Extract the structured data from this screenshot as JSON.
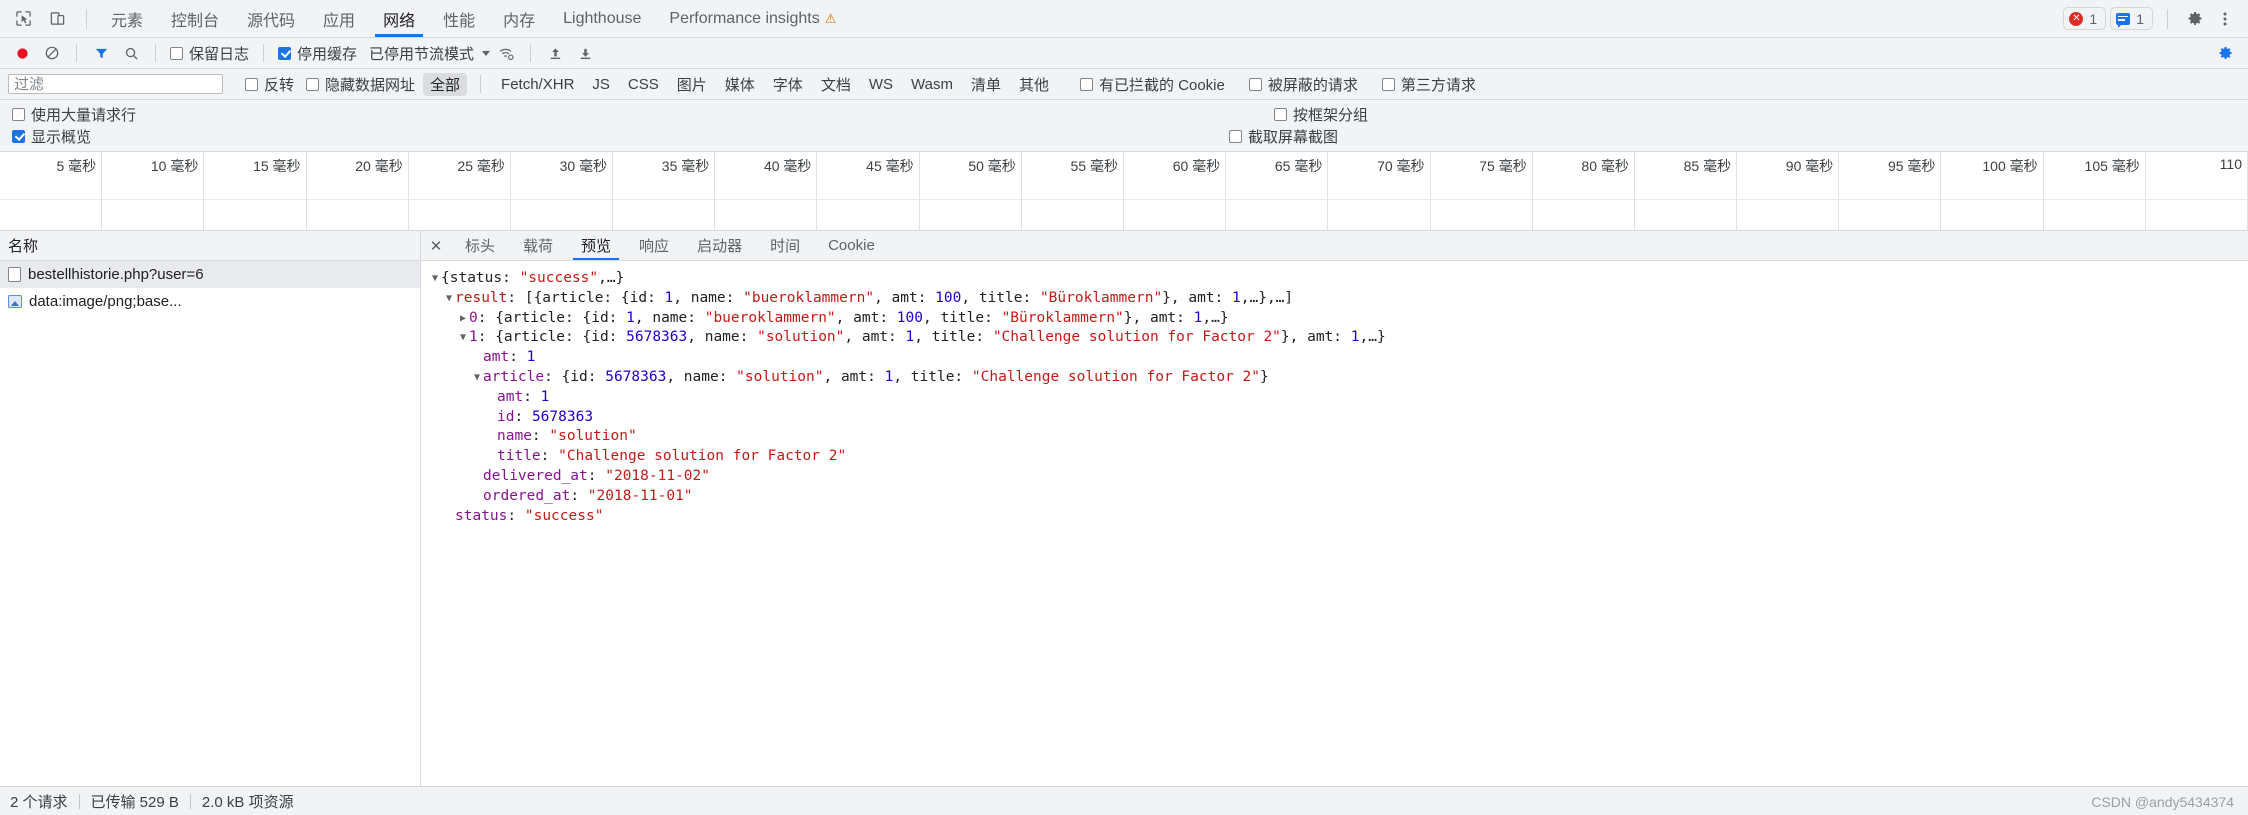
{
  "window": {
    "title": "Chrome DevTools - Network"
  },
  "toolbar": {
    "inspect_icon": "inspect-cursor-icon",
    "device_icon": "device-toggle-icon",
    "tabs": [
      {
        "label": "元素",
        "selected": false,
        "warning": false
      },
      {
        "label": "控制台",
        "selected": false,
        "warning": false
      },
      {
        "label": "源代码",
        "selected": false,
        "warning": false
      },
      {
        "label": "应用",
        "selected": false,
        "warning": false
      },
      {
        "label": "网络",
        "selected": true,
        "warning": false
      },
      {
        "label": "性能",
        "selected": false,
        "warning": false
      },
      {
        "label": "内存",
        "selected": false,
        "warning": false
      },
      {
        "label": "Lighthouse",
        "selected": false,
        "warning": false
      },
      {
        "label": "Performance insights",
        "selected": false,
        "warning": true
      }
    ],
    "warning_glyph": "⚠",
    "error_badge": {
      "icon": "error-circle-icon",
      "count": "1"
    },
    "message_badge": {
      "icon": "message-box-icon",
      "count": "1"
    },
    "settings_icon": "gear-icon",
    "more_icon": "kebab-menu-icon"
  },
  "network_controls": {
    "record_icon": "record-circle-icon",
    "clear_icon": "clear-prohibited-icon",
    "filter_icon": "filter-funnel-icon",
    "search_icon": "search-magnifier-icon",
    "preserve_log": {
      "label": "保留日志",
      "checked": false
    },
    "disable_cache": {
      "label": "停用缓存",
      "checked": true
    },
    "throttling": {
      "label": "已停用节流模式",
      "caret": "▾"
    },
    "wifi_icon": "network-conditions-icon",
    "import_icon": "import-har-upload-icon",
    "export_icon": "export-har-download-icon",
    "settings_icon": "network-settings-gear-icon"
  },
  "filter_bar": {
    "filter_input": {
      "placeholder": "过滤",
      "value": ""
    },
    "invert": {
      "label": "反转",
      "checked": false
    },
    "hide_data_urls": {
      "label": "隐藏数据网址",
      "checked": false
    },
    "types": [
      {
        "label": "全部",
        "selected": true
      },
      {
        "label": "Fetch/XHR",
        "selected": false
      },
      {
        "label": "JS",
        "selected": false
      },
      {
        "label": "CSS",
        "selected": false
      },
      {
        "label": "图片",
        "selected": false
      },
      {
        "label": "媒体",
        "selected": false
      },
      {
        "label": "字体",
        "selected": false
      },
      {
        "label": "文档",
        "selected": false
      },
      {
        "label": "WS",
        "selected": false
      },
      {
        "label": "Wasm",
        "selected": false
      },
      {
        "label": "清单",
        "selected": false
      },
      {
        "label": "其他",
        "selected": false
      }
    ],
    "blocked_cookies": {
      "label": "有已拦截的 Cookie",
      "checked": false
    },
    "blocked_requests": {
      "label": "被屏蔽的请求",
      "checked": false
    },
    "third_party": {
      "label": "第三方请求",
      "checked": false
    }
  },
  "options": {
    "big_request_rows": {
      "label": "使用大量请求行",
      "checked": false
    },
    "group_by_frame": {
      "label": "按框架分组",
      "checked": false
    },
    "show_overview": {
      "label": "显示概览",
      "checked": true
    },
    "capture_screenshots": {
      "label": "截取屏幕截图",
      "checked": false
    }
  },
  "overview": {
    "unit": "毫秒",
    "ticks": [
      "5 毫秒",
      "10 毫秒",
      "15 毫秒",
      "20 毫秒",
      "25 毫秒",
      "30 毫秒",
      "35 毫秒",
      "40 毫秒",
      "45 毫秒",
      "50 毫秒",
      "55 毫秒",
      "60 毫秒",
      "65 毫秒",
      "70 毫秒",
      "75 毫秒",
      "80 毫秒",
      "85 毫秒",
      "90 毫秒",
      "95 毫秒",
      "100 毫秒",
      "105 毫秒",
      "110"
    ],
    "tick_interval_ms": 5,
    "max_ms": 110
  },
  "request_list": {
    "column_header": "名称",
    "rows": [
      {
        "name": "bestellhistorie.php?user=6",
        "icon": "document-file-icon",
        "selected": true
      },
      {
        "name": "data:image/png;base...",
        "icon": "image-file-icon",
        "selected": false
      }
    ]
  },
  "detail_panel": {
    "close_label": "✕",
    "tabs": [
      {
        "label": "标头",
        "selected": false
      },
      {
        "label": "载荷",
        "selected": false
      },
      {
        "label": "预览",
        "selected": true
      },
      {
        "label": "响应",
        "selected": false
      },
      {
        "label": "启动器",
        "selected": false
      },
      {
        "label": "时间",
        "selected": false
      },
      {
        "label": "Cookie",
        "selected": false
      }
    ],
    "preview_tree": [
      {
        "indent": 0,
        "tri": "▼",
        "segments": [
          {
            "t": "{status: ",
            "c": "plain"
          },
          {
            "t": "\"success\"",
            "c": "str"
          },
          {
            "t": ",…}",
            "c": "plain"
          }
        ]
      },
      {
        "indent": 1,
        "tri": "▼",
        "segments": [
          {
            "t": "result",
            "c": "k-res"
          },
          {
            "t": ": [{article: {id: ",
            "c": "plain"
          },
          {
            "t": "1",
            "c": "num"
          },
          {
            "t": ", name: ",
            "c": "plain"
          },
          {
            "t": "\"bueroklammern\"",
            "c": "str"
          },
          {
            "t": ", amt: ",
            "c": "plain"
          },
          {
            "t": "100",
            "c": "num"
          },
          {
            "t": ", title: ",
            "c": "plain"
          },
          {
            "t": "\"Büroklammern\"",
            "c": "str"
          },
          {
            "t": "}, amt: ",
            "c": "plain"
          },
          {
            "t": "1",
            "c": "num"
          },
          {
            "t": ",…},…]",
            "c": "plain"
          }
        ]
      },
      {
        "indent": 2,
        "tri": "▶",
        "segments": [
          {
            "t": "0",
            "c": "k-name"
          },
          {
            "t": ": {article: {id: ",
            "c": "plain"
          },
          {
            "t": "1",
            "c": "num"
          },
          {
            "t": ", name: ",
            "c": "plain"
          },
          {
            "t": "\"bueroklammern\"",
            "c": "str"
          },
          {
            "t": ", amt: ",
            "c": "plain"
          },
          {
            "t": "100",
            "c": "num"
          },
          {
            "t": ", title: ",
            "c": "plain"
          },
          {
            "t": "\"Büroklammern\"",
            "c": "str"
          },
          {
            "t": "}, amt: ",
            "c": "plain"
          },
          {
            "t": "1",
            "c": "num"
          },
          {
            "t": ",…}",
            "c": "plain"
          }
        ]
      },
      {
        "indent": 2,
        "tri": "▼",
        "segments": [
          {
            "t": "1",
            "c": "k-name"
          },
          {
            "t": ": {article: {id: ",
            "c": "plain"
          },
          {
            "t": "5678363",
            "c": "num"
          },
          {
            "t": ", name: ",
            "c": "plain"
          },
          {
            "t": "\"solution\"",
            "c": "str"
          },
          {
            "t": ", amt: ",
            "c": "plain"
          },
          {
            "t": "1",
            "c": "num"
          },
          {
            "t": ", title: ",
            "c": "plain"
          },
          {
            "t": "\"Challenge solution for Factor 2\"",
            "c": "str"
          },
          {
            "t": "}, amt: ",
            "c": "plain"
          },
          {
            "t": "1",
            "c": "num"
          },
          {
            "t": ",…}",
            "c": "plain"
          }
        ]
      },
      {
        "indent": 3,
        "tri": "",
        "segments": [
          {
            "t": "amt",
            "c": "k-name"
          },
          {
            "t": ": ",
            "c": "plain"
          },
          {
            "t": "1",
            "c": "num"
          }
        ]
      },
      {
        "indent": 3,
        "tri": "▼",
        "segments": [
          {
            "t": "article",
            "c": "k-name"
          },
          {
            "t": ": {id: ",
            "c": "plain"
          },
          {
            "t": "5678363",
            "c": "num"
          },
          {
            "t": ", name: ",
            "c": "plain"
          },
          {
            "t": "\"solution\"",
            "c": "str"
          },
          {
            "t": ", amt: ",
            "c": "plain"
          },
          {
            "t": "1",
            "c": "num"
          },
          {
            "t": ", title: ",
            "c": "plain"
          },
          {
            "t": "\"Challenge solution for Factor 2\"",
            "c": "str"
          },
          {
            "t": "}",
            "c": "plain"
          }
        ]
      },
      {
        "indent": 4,
        "tri": "",
        "segments": [
          {
            "t": "amt",
            "c": "k-name"
          },
          {
            "t": ": ",
            "c": "plain"
          },
          {
            "t": "1",
            "c": "num"
          }
        ]
      },
      {
        "indent": 4,
        "tri": "",
        "segments": [
          {
            "t": "id",
            "c": "k-name"
          },
          {
            "t": ": ",
            "c": "plain"
          },
          {
            "t": "5678363",
            "c": "num"
          }
        ]
      },
      {
        "indent": 4,
        "tri": "",
        "segments": [
          {
            "t": "name",
            "c": "k-name"
          },
          {
            "t": ": ",
            "c": "plain"
          },
          {
            "t": "\"solution\"",
            "c": "str"
          }
        ]
      },
      {
        "indent": 4,
        "tri": "",
        "segments": [
          {
            "t": "title",
            "c": "k-name"
          },
          {
            "t": ": ",
            "c": "plain"
          },
          {
            "t": "\"Challenge solution for Factor 2\"",
            "c": "str"
          }
        ]
      },
      {
        "indent": 3,
        "tri": "",
        "segments": [
          {
            "t": "delivered_at",
            "c": "k-name"
          },
          {
            "t": ": ",
            "c": "plain"
          },
          {
            "t": "\"2018-11-02\"",
            "c": "str"
          }
        ]
      },
      {
        "indent": 3,
        "tri": "",
        "segments": [
          {
            "t": "ordered_at",
            "c": "k-name"
          },
          {
            "t": ": ",
            "c": "plain"
          },
          {
            "t": "\"2018-11-01\"",
            "c": "str"
          }
        ]
      },
      {
        "indent": 1,
        "tri": "",
        "segments": [
          {
            "t": "status",
            "c": "k-name"
          },
          {
            "t": ": ",
            "c": "plain"
          },
          {
            "t": "\"success\"",
            "c": "str"
          }
        ]
      }
    ]
  },
  "status_bar": {
    "requests": "2 个请求",
    "transferred": "已传输 529 B",
    "resources": "2.0 kB 项资源"
  },
  "watermark": "CSDN @andy5434374",
  "colors": {
    "accent": "#1a73e8",
    "toolbar_bg": "#f1f3f4",
    "border": "#d6d8da",
    "error": "#d93025",
    "string": "#c41a16",
    "number": "#1c00cf",
    "key": "#881391"
  }
}
